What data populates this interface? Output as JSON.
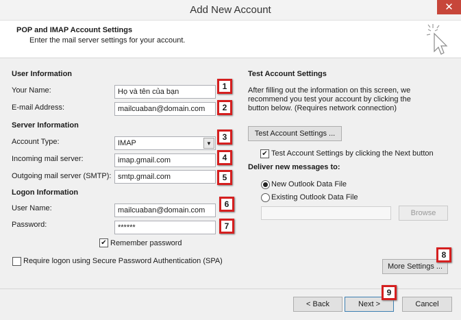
{
  "window": {
    "title": "Add New Account",
    "close_glyph": "✕"
  },
  "header": {
    "title": "POP and IMAP Account Settings",
    "subtitle": "Enter the mail server settings for your account."
  },
  "user_info": {
    "heading": "User Information",
    "name_label": "Your Name:",
    "name_value": "Họ và tên của bạn",
    "email_label": "E-mail Address:",
    "email_value": "mailcuaban@domain.com"
  },
  "server_info": {
    "heading": "Server Information",
    "type_label": "Account Type:",
    "type_value": "IMAP",
    "incoming_label": "Incoming mail server:",
    "incoming_value": "imap.gmail.com",
    "outgoing_label": "Outgoing mail server (SMTP):",
    "outgoing_value": "smtp.gmail.com"
  },
  "logon_info": {
    "heading": "Logon Information",
    "username_label": "User Name:",
    "username_value": "mailcuaban@domain.com",
    "password_label": "Password:",
    "password_value": "******",
    "remember_label": "Remember password",
    "remember_checked": "✔",
    "spa_label": "Require logon using Secure Password Authentication (SPA)"
  },
  "test_settings": {
    "heading": "Test Account Settings",
    "description": "After filling out the information on this screen, we recommend you test your account by clicking the button below. (Requires network connection)",
    "test_button": "Test Account Settings ...",
    "auto_test_label": "Test Account Settings by clicking the Next button",
    "auto_test_checked": "✔"
  },
  "deliver": {
    "heading": "Deliver new messages to:",
    "new_pst_label": "New Outlook Data File",
    "existing_pst_label": "Existing Outlook Data File",
    "browse_button": "Browse"
  },
  "more_settings_button": "More Settings ...",
  "footer": {
    "back": "< Back",
    "next": "Next >",
    "cancel": "Cancel"
  },
  "markers": [
    "1",
    "2",
    "3",
    "4",
    "5",
    "6",
    "7",
    "8",
    "9"
  ],
  "colors": {
    "marker_border": "#d51f1f",
    "close_bg": "#c7463a"
  }
}
